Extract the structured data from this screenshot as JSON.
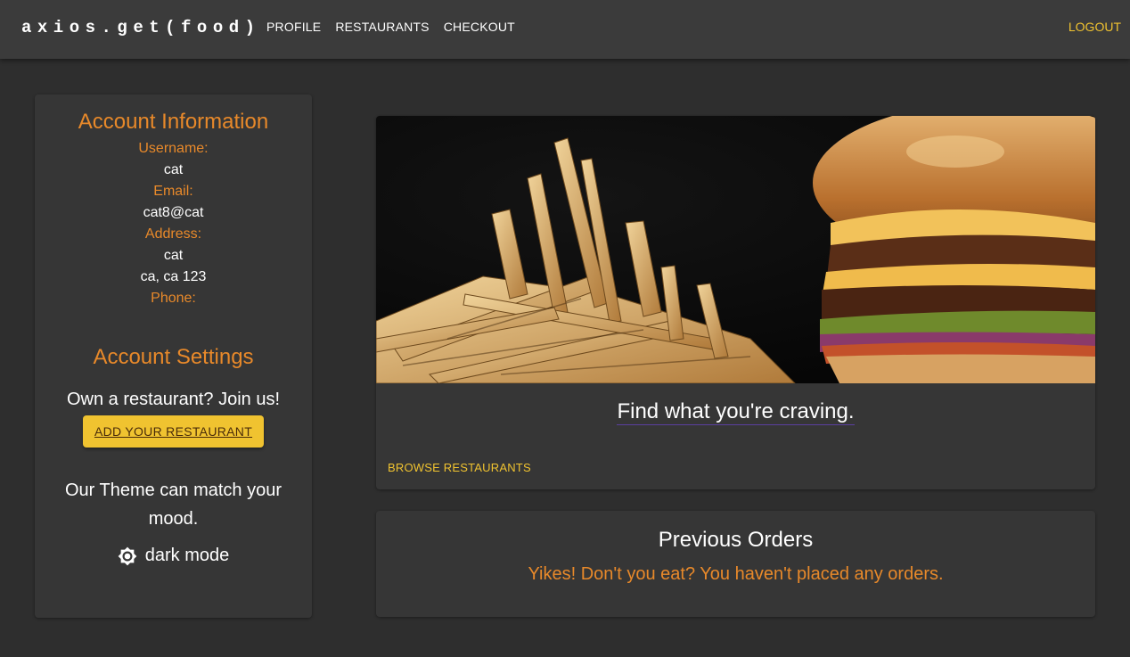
{
  "header": {
    "brand": "axios.get(food)",
    "nav": [
      "PROFILE",
      "RESTAURANTS",
      "CHECKOUT"
    ],
    "logout": "LOGOUT"
  },
  "account": {
    "title": "Account Information",
    "username_label": "Username:",
    "username": "cat",
    "email_label": "Email:",
    "email": "cat8@cat",
    "address_label": "Address:",
    "address_line1": "cat",
    "address_line2": "ca, ca 123",
    "phone_label": "Phone:"
  },
  "settings": {
    "title": "Account Settings",
    "own_restaurant": "Own a restaurant? Join us!",
    "add_button": "ADD YOUR RESTAURANT",
    "theme_text": "Our Theme can match your mood.",
    "mode_label": "dark mode",
    "mode_icon": "brightness-icon"
  },
  "hero": {
    "tagline": "Find what you're craving.",
    "browse": "BROWSE RESTAURANTS",
    "image": "burger-and-fries-photo"
  },
  "orders": {
    "title": "Previous Orders",
    "empty_message": "Yikes! Don't you eat? You haven't placed any orders."
  },
  "colors": {
    "accent": "#f0c330",
    "label": "#e8892a",
    "background": "#2e2e2e",
    "card": "#363636",
    "appbar": "#3b3b3b"
  }
}
